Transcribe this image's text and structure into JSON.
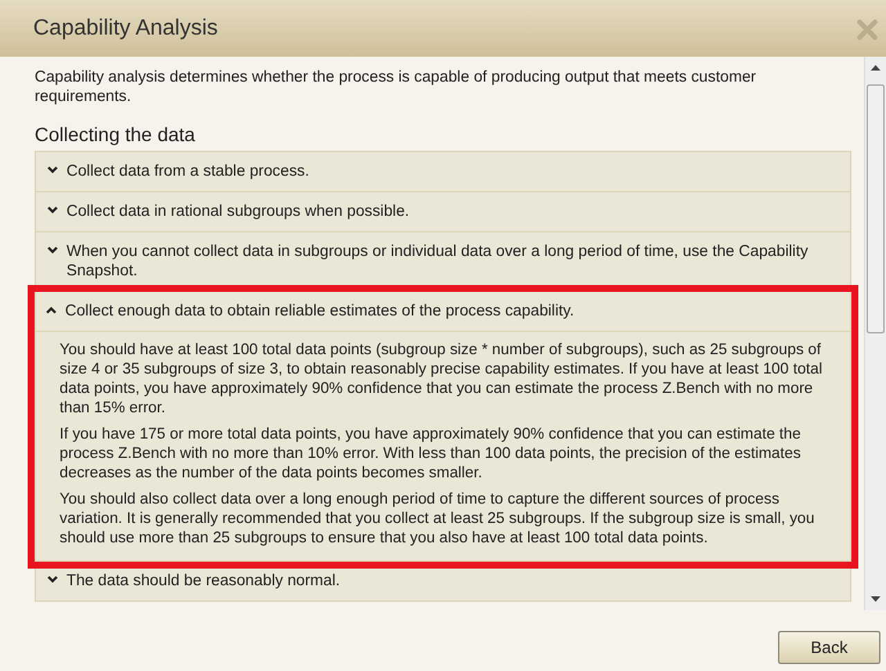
{
  "window": {
    "title": "Capability Analysis"
  },
  "intro": "Capability analysis determines whether the process is capable of producing output that meets customer requirements.",
  "section_heading": "Collecting the data",
  "items": [
    {
      "title": "Collect data from a stable process.",
      "expanded": false,
      "highlighted": false
    },
    {
      "title": "Collect data in rational subgroups when possible.",
      "expanded": false,
      "highlighted": false
    },
    {
      "title": "When you cannot collect data in subgroups or individual data over a long period of time, use the Capability Snapshot.",
      "expanded": false,
      "highlighted": false
    },
    {
      "title": "Collect enough data to obtain reliable estimates of the process capability.",
      "expanded": true,
      "highlighted": true,
      "paragraphs": [
        "You should have at least 100 total data points (subgroup size * number of subgroups), such as 25 subgroups of size 4 or 35 subgroups of size 3, to obtain reasonably precise capability estimates. If you have at least 100 total data points, you have approximately 90% confidence that you can estimate the process Z.Bench with no more than 15% error.",
        "If you have 175 or more total data points, you have approximately 90% confidence that you can estimate the process Z.Bench with no more than 10% error. With less than 100 data points, the precision of the estimates decreases as the number of the data points becomes smaller.",
        "You should also collect data over a long enough period of time to capture the different sources of process variation. It is generally recommended that you collect at least 25 subgroups. If the subgroup size is small, you should use more than 25 subgroups to ensure that you also have at least 100 total data points."
      ]
    },
    {
      "title": "The data should be reasonably normal.",
      "expanded": false,
      "highlighted": false
    }
  ],
  "buttons": [
    "Back"
  ]
}
